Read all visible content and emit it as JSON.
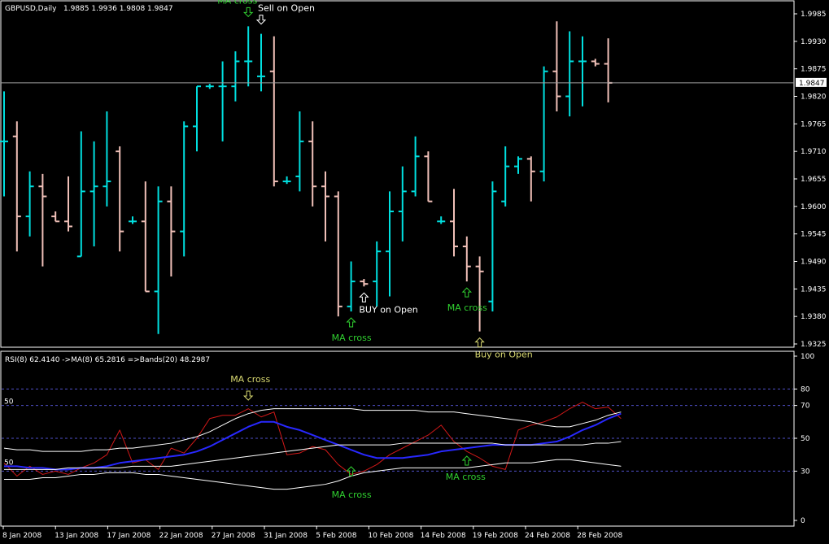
{
  "colors": {
    "background": "#000000",
    "frame": "#ffffff",
    "bull_bar": "#00e0e0",
    "bear_bar": "#f0c0b8",
    "grid": "#5050c8",
    "rsi_line": "#d01818",
    "rsi_ma_line": "#2828ff",
    "bands": "#ffffff",
    "signal_green": "#30d030",
    "signal_yellow": "#d8d870",
    "current_price_line": "#a0a0a0"
  },
  "price_panel": {
    "title": "GBPUSD,Daily",
    "ohlc_header": "1.9885 1.9936 1.9808 1.9847",
    "current_price_label": "1.9847",
    "current_price": 1.9847,
    "y_ticks": [
      "1.9985",
      "1.9930",
      "1.9875",
      "1.9820",
      "1.9765",
      "1.9710",
      "1.9655",
      "1.9600",
      "1.9545",
      "1.9490",
      "1.9435",
      "1.9380",
      "1.9325"
    ]
  },
  "rsi_panel": {
    "header": "RSI(8) 62.4140 ->MA(8) 65.2816 =>Bands(20) 48.2987",
    "y_ticks": [
      "100",
      "80",
      "70",
      "50",
      "30",
      "0"
    ],
    "level_lines": [
      80,
      70,
      50,
      30
    ],
    "left_level_labels": [
      "50",
      "50"
    ]
  },
  "x_axis": {
    "labels": [
      "8 Jan 2008",
      "13 Jan 2008",
      "17 Jan 2008",
      "22 Jan 2008",
      "27 Jan 2008",
      "31 Jan 2008",
      "5 Feb 2008",
      "10 Feb 2008",
      "14 Feb 2008",
      "19 Feb 2008",
      "24 Feb 2008",
      "28 Feb 2008"
    ]
  },
  "annotations": {
    "price": [
      {
        "text": "MA cross",
        "bar": 19,
        "color": "green",
        "kind": "label_above"
      },
      {
        "text": "Sell on Open",
        "bar": 20,
        "color": "white",
        "kind": "label_right"
      },
      {
        "text": "BUY on Open",
        "bar": 28,
        "color": "white",
        "kind": "label_below"
      },
      {
        "text": "MA cross",
        "bar": 27,
        "color": "green",
        "kind": "label_below"
      },
      {
        "text": "Buy on Open",
        "bar": 37,
        "color": "yellow",
        "kind": "label_below"
      },
      {
        "text": "MA cross",
        "bar": 36,
        "color": "green",
        "kind": "label_below"
      }
    ],
    "rsi": [
      {
        "text": "MA cross",
        "bar": 19,
        "color": "yellow",
        "kind": "label_above"
      },
      {
        "text": "MA cross",
        "bar": 27,
        "color": "green",
        "kind": "label_below"
      },
      {
        "text": "MA cross",
        "bar": 36,
        "color": "green",
        "kind": "label_below"
      }
    ]
  },
  "chart_data": [
    {
      "type": "ohlc",
      "symbol": "GBPUSD",
      "timeframe": "Daily",
      "title": "GBPUSD,Daily",
      "ylim": [
        1.9325,
        1.9985
      ],
      "bars": [
        {
          "o": 1.973,
          "h": 1.983,
          "l": 1.962,
          "c": 1.973
        },
        {
          "o": 1.974,
          "h": 1.977,
          "l": 1.951,
          "c": 1.958
        },
        {
          "o": 1.958,
          "h": 1.967,
          "l": 1.954,
          "c": 1.964
        },
        {
          "o": 1.964,
          "h": 1.9665,
          "l": 1.948,
          "c": 1.962
        },
        {
          "o": 1.958,
          "h": 1.959,
          "l": 1.957,
          "c": 1.957
        },
        {
          "o": 1.957,
          "h": 1.966,
          "l": 1.955,
          "c": 1.956
        },
        {
          "o": 1.95,
          "h": 1.975,
          "l": 1.95,
          "c": 1.963
        },
        {
          "o": 1.963,
          "h": 1.973,
          "l": 1.952,
          "c": 1.964
        },
        {
          "o": 1.964,
          "h": 1.979,
          "l": 1.96,
          "c": 1.965
        },
        {
          "o": 1.971,
          "h": 1.972,
          "l": 1.951,
          "c": 1.955
        },
        {
          "o": 1.957,
          "h": 1.958,
          "l": 1.9565,
          "c": 1.957
        },
        {
          "o": 1.957,
          "h": 1.965,
          "l": 1.943,
          "c": 1.943
        },
        {
          "o": 1.943,
          "h": 1.964,
          "l": 1.9345,
          "c": 1.961
        },
        {
          "o": 1.961,
          "h": 1.964,
          "l": 1.946,
          "c": 1.955
        },
        {
          "o": 1.955,
          "h": 1.977,
          "l": 1.95,
          "c": 1.976
        },
        {
          "o": 1.976,
          "h": 1.984,
          "l": 1.971,
          "c": 1.984
        },
        {
          "o": 1.984,
          "h": 1.9845,
          "l": 1.9835,
          "c": 1.984
        },
        {
          "o": 1.984,
          "h": 1.989,
          "l": 1.973,
          "c": 1.984
        },
        {
          "o": 1.984,
          "h": 1.991,
          "l": 1.981,
          "c": 1.989
        },
        {
          "o": 1.989,
          "h": 1.996,
          "l": 1.984,
          "c": 1.989
        },
        {
          "o": 1.986,
          "h": 1.9945,
          "l": 1.983,
          "c": 1.986
        },
        {
          "o": 1.987,
          "h": 1.994,
          "l": 1.964,
          "c": 1.965
        },
        {
          "o": 1.965,
          "h": 1.966,
          "l": 1.9645,
          "c": 1.965
        },
        {
          "o": 1.966,
          "h": 1.979,
          "l": 1.963,
          "c": 1.973
        },
        {
          "o": 1.973,
          "h": 1.977,
          "l": 1.96,
          "c": 1.964
        },
        {
          "o": 1.964,
          "h": 1.967,
          "l": 1.953,
          "c": 1.962
        },
        {
          "o": 1.962,
          "h": 1.963,
          "l": 1.938,
          "c": 1.94
        },
        {
          "o": 1.94,
          "h": 1.949,
          "l": 1.939,
          "c": 1.945
        },
        {
          "o": 1.945,
          "h": 1.9455,
          "l": 1.944,
          "c": 1.9445
        },
        {
          "o": 1.945,
          "h": 1.953,
          "l": 1.94,
          "c": 1.951
        },
        {
          "o": 1.951,
          "h": 1.963,
          "l": 1.942,
          "c": 1.959
        },
        {
          "o": 1.959,
          "h": 1.968,
          "l": 1.953,
          "c": 1.963
        },
        {
          "o": 1.963,
          "h": 1.974,
          "l": 1.962,
          "c": 1.97
        },
        {
          "o": 1.97,
          "h": 1.971,
          "l": 1.961,
          "c": 1.961
        },
        {
          "o": 1.957,
          "h": 1.958,
          "l": 1.9565,
          "c": 1.957
        },
        {
          "o": 1.957,
          "h": 1.9635,
          "l": 1.95,
          "c": 1.952
        },
        {
          "o": 1.952,
          "h": 1.954,
          "l": 1.945,
          "c": 1.948
        },
        {
          "o": 1.948,
          "h": 1.95,
          "l": 1.935,
          "c": 1.947
        },
        {
          "o": 1.941,
          "h": 1.965,
          "l": 1.939,
          "c": 1.963
        },
        {
          "o": 1.961,
          "h": 1.972,
          "l": 1.96,
          "c": 1.968
        },
        {
          "o": 1.968,
          "h": 1.97,
          "l": 1.9665,
          "c": 1.9695
        },
        {
          "o": 1.9695,
          "h": 1.97,
          "l": 1.961,
          "c": 1.967
        },
        {
          "o": 1.967,
          "h": 1.988,
          "l": 1.965,
          "c": 1.987
        },
        {
          "o": 1.987,
          "h": 1.997,
          "l": 1.979,
          "c": 1.982
        },
        {
          "o": 1.982,
          "h": 1.995,
          "l": 1.978,
          "c": 1.989
        },
        {
          "o": 1.989,
          "h": 1.994,
          "l": 1.98,
          "c": 1.989
        },
        {
          "o": 1.989,
          "h": 1.9895,
          "l": 1.988,
          "c": 1.9885
        },
        {
          "o": 1.9885,
          "h": 1.9936,
          "l": 1.9808,
          "c": 1.9847
        }
      ]
    },
    {
      "type": "line",
      "title": "RSI(8) 62.4140 ->MA(8) 65.2816 =>Bands(20) 48.2987",
      "ylim": [
        0,
        100
      ],
      "x": [
        0,
        1,
        2,
        3,
        4,
        5,
        6,
        7,
        8,
        9,
        10,
        11,
        12,
        13,
        14,
        15,
        16,
        17,
        18,
        19,
        20,
        21,
        22,
        23,
        24,
        25,
        26,
        27,
        28,
        29,
        30,
        31,
        32,
        33,
        34,
        35,
        36,
        37,
        38,
        39,
        40,
        41,
        42,
        43,
        44,
        45,
        46,
        47
      ],
      "series": [
        {
          "name": "RSI(8)",
          "values": [
            35,
            27,
            33,
            28,
            30,
            28,
            32,
            35,
            40,
            55,
            35,
            37,
            31,
            44,
            41,
            50,
            62,
            64,
            64,
            68,
            63,
            66,
            40,
            41,
            45,
            43,
            34,
            28,
            30,
            34,
            40,
            44,
            48,
            52,
            58,
            48,
            42,
            38,
            33,
            31,
            55,
            58,
            60,
            63,
            68,
            72,
            68,
            69,
            62
          ]
        },
        {
          "name": "MA(8)",
          "values": [
            33,
            33,
            32,
            32,
            31,
            31,
            32,
            32,
            33,
            35,
            36,
            37,
            38,
            39,
            40,
            42,
            45,
            49,
            53,
            57,
            60,
            60,
            57,
            55,
            52,
            49,
            46,
            43,
            40,
            38,
            38,
            38,
            39,
            40,
            42,
            43,
            44,
            45,
            46,
            46,
            46,
            46,
            47,
            48,
            51,
            55,
            58,
            62,
            65
          ]
        },
        {
          "name": "Upper Band",
          "values": [
            44,
            43,
            43,
            42,
            42,
            42,
            42,
            43,
            43,
            44,
            44,
            45,
            46,
            47,
            49,
            51,
            54,
            58,
            62,
            65,
            67,
            68,
            68,
            68,
            68,
            68,
            68,
            68,
            67,
            67,
            67,
            67,
            67,
            66,
            66,
            66,
            65,
            64,
            63,
            62,
            61,
            60,
            58,
            57,
            57,
            59,
            61,
            64,
            66
          ]
        },
        {
          "name": "Lower Band",
          "values": [
            25,
            25,
            25,
            26,
            26,
            27,
            28,
            28,
            29,
            29,
            29,
            28,
            28,
            27,
            26,
            25,
            24,
            23,
            22,
            21,
            20,
            19,
            19,
            20,
            21,
            22,
            24,
            27,
            29,
            30,
            31,
            32,
            32,
            32,
            32,
            32,
            32,
            33,
            34,
            35,
            35,
            35,
            36,
            37,
            37,
            36,
            35,
            34,
            33
          ]
        },
        {
          "name": "Bands(20)",
          "values": [
            31,
            31,
            31,
            31,
            31,
            32,
            32,
            32,
            32,
            32,
            33,
            33,
            33,
            33,
            34,
            35,
            36,
            37,
            38,
            39,
            40,
            41,
            42,
            43,
            44,
            45,
            46,
            46,
            46,
            46,
            46,
            47,
            47,
            47,
            47,
            47,
            47,
            47,
            47,
            46,
            46,
            46,
            46,
            46,
            46,
            46,
            47,
            47,
            48
          ]
        }
      ]
    }
  ]
}
